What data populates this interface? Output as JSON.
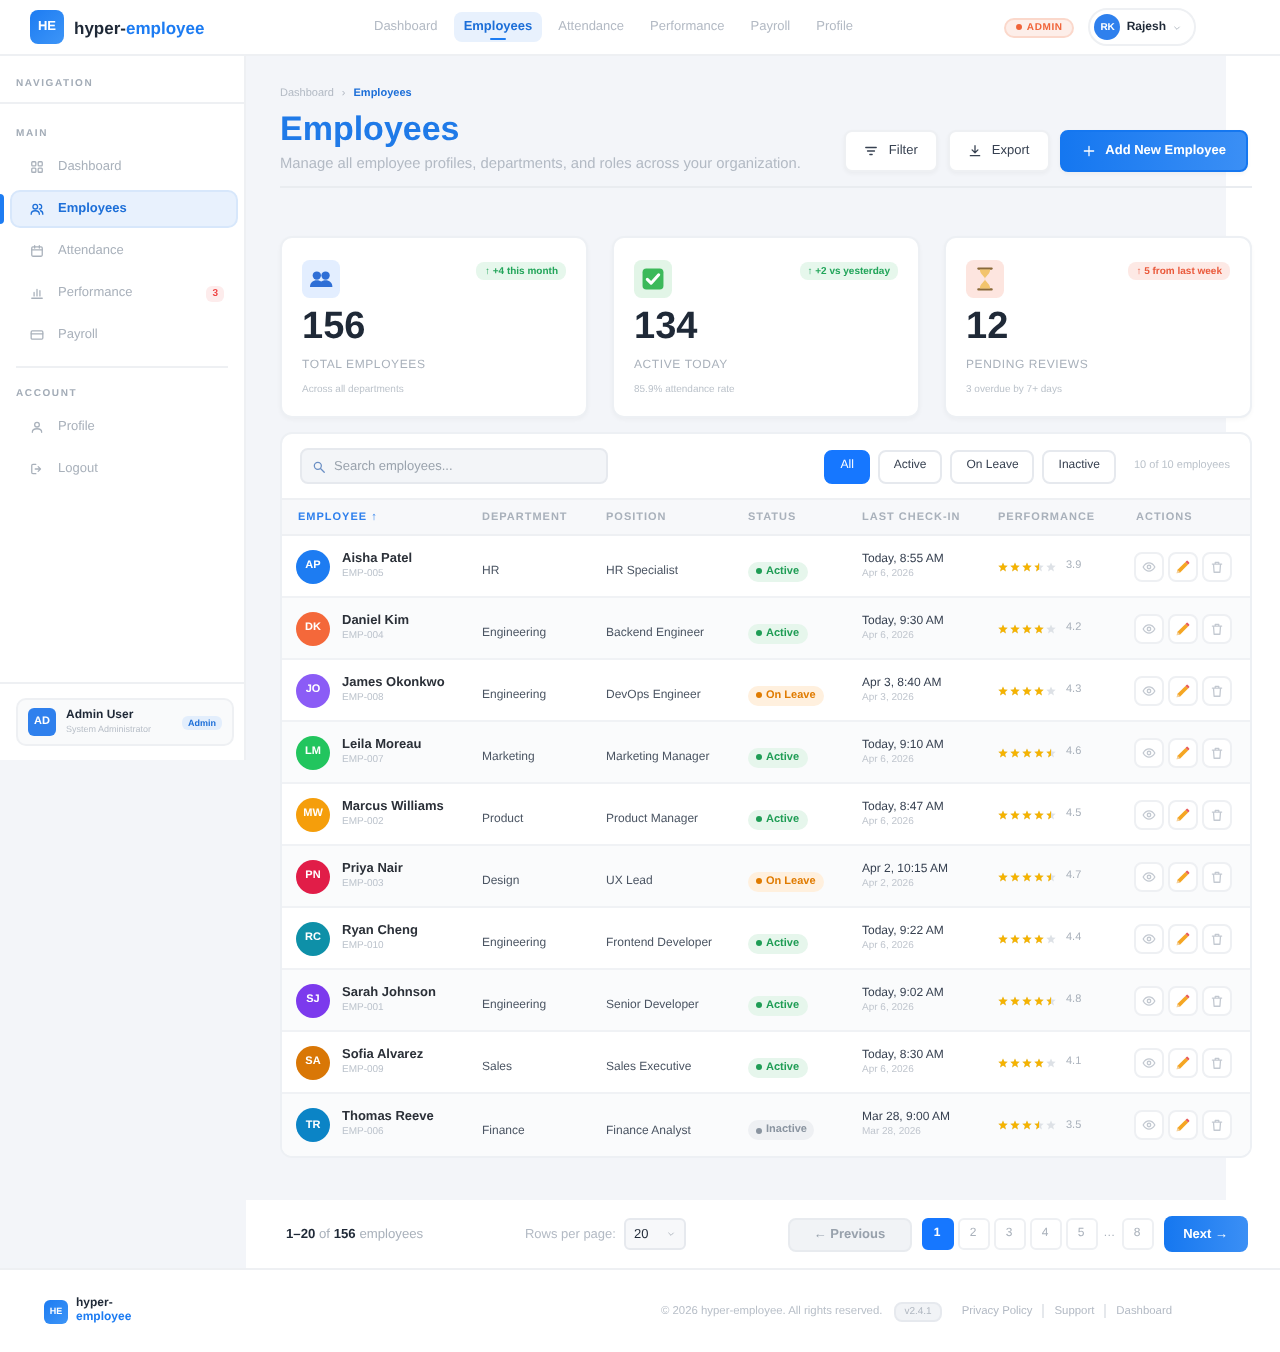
{
  "header": {
    "logo": "HE",
    "brand": {
      "part_1": "hyper-",
      "part_2": "employee"
    },
    "nav": [
      {
        "label": "Dashboard",
        "selected": false
      },
      {
        "label": "Employees",
        "selected": true
      },
      {
        "label": "Attendance",
        "selected": false
      },
      {
        "label": "Performance",
        "selected": false
      },
      {
        "label": "Payroll",
        "selected": false
      },
      {
        "label": "Profile",
        "selected": false
      }
    ],
    "role_badge": "ADMIN",
    "user": {
      "initials": "RK",
      "name": "Rajesh"
    }
  },
  "sidebar": {
    "heading": "NAVIGATION",
    "sections": [
      {
        "title": "MAIN",
        "items": [
          {
            "label": "Dashboard",
            "selected": false
          },
          {
            "label": "Employees",
            "selected": true
          },
          {
            "label": "Attendance",
            "selected": false
          },
          {
            "label": "Performance",
            "selected": false,
            "badge": "3"
          },
          {
            "label": "Payroll",
            "selected": false
          }
        ]
      },
      {
        "title": "ACCOUNT",
        "items": [
          {
            "label": "Profile",
            "selected": false
          },
          {
            "label": "Logout",
            "selected": false
          }
        ]
      }
    ],
    "user_card": {
      "initials": "AD",
      "name": "Admin User",
      "role": "System Administrator",
      "badge": "Admin"
    }
  },
  "page": {
    "breadcrumb": {
      "separator": "›",
      "items": [
        {
          "label": "Dashboard",
          "current": false
        },
        {
          "label": "Employees",
          "current": true
        }
      ]
    },
    "title": "Employees",
    "subtitle": "Manage all employee profiles, departments, and roles across your organization.",
    "actions": [
      {
        "label": "Filter",
        "kind": "secondary"
      },
      {
        "label": "Export",
        "kind": "secondary"
      },
      {
        "label": "Add New Employee",
        "kind": "primary"
      }
    ]
  },
  "stats": [
    {
      "trend": {
        "label": "↑ +4 this month",
        "kind": "good"
      },
      "value": "156",
      "label": "TOTAL EMPLOYEES",
      "note": "Across all departments"
    },
    {
      "trend": {
        "label": "↑ +2 vs yesterday",
        "kind": "good"
      },
      "value": "134",
      "label": "ACTIVE TODAY",
      "note": "85.9% attendance rate"
    },
    {
      "trend": {
        "label": "↑ 5 from last week",
        "kind": "bad"
      },
      "value": "12",
      "label": "PENDING REVIEWS",
      "note": "3 overdue by 7+ days"
    }
  ],
  "table": {
    "search": {
      "placeholder": "Search employees..."
    },
    "filters": [
      {
        "label": "All",
        "selected": true
      },
      {
        "label": "Active",
        "selected": false
      },
      {
        "label": "On Leave",
        "selected": false
      },
      {
        "label": "Inactive",
        "selected": false
      }
    ],
    "count": "10 of 10 employees",
    "columns": [
      {
        "label": "EMPLOYEE",
        "sorted": true,
        "sort_indicator": "↑"
      },
      {
        "label": "DEPARTMENT",
        "sorted": false
      },
      {
        "label": "POSITION",
        "sorted": false
      },
      {
        "label": "STATUS",
        "sorted": false
      },
      {
        "label": "LAST CHECK-IN",
        "sorted": false
      },
      {
        "label": "PERFORMANCE",
        "sorted": false
      },
      {
        "label": "ACTIONS",
        "sorted": false
      }
    ],
    "rows": [
      {
        "initials": "AP",
        "color": "#1d7cf2",
        "name": "Aisha Patel",
        "id": "EMP-005",
        "department": "HR",
        "position": "HR Specialist",
        "status": {
          "kind": "active",
          "label": "Active"
        },
        "check_in": "Today, 8:55 AM",
        "check_in_date": "Apr 6, 2026",
        "stars": 3.5,
        "rating": "3.9"
      },
      {
        "initials": "DK",
        "color": "#f4683a",
        "name": "Daniel Kim",
        "id": "EMP-004",
        "department": "Engineering",
        "position": "Backend Engineer",
        "status": {
          "kind": "active",
          "label": "Active"
        },
        "check_in": "Today, 9:30 AM",
        "check_in_date": "Apr 6, 2026",
        "stars": 4,
        "rating": "4.2"
      },
      {
        "initials": "JO",
        "color": "#8b5cf6",
        "name": "James Okonkwo",
        "id": "EMP-008",
        "department": "Engineering",
        "position": "DevOps Engineer",
        "status": {
          "kind": "on_leave",
          "label": "On Leave"
        },
        "check_in": "Apr 3, 8:40 AM",
        "check_in_date": "Apr 3, 2026",
        "stars": 4,
        "rating": "4.3"
      },
      {
        "initials": "LM",
        "color": "#22c55e",
        "name": "Leila Moreau",
        "id": "EMP-007",
        "department": "Marketing",
        "position": "Marketing Manager",
        "status": {
          "kind": "active",
          "label": "Active"
        },
        "check_in": "Today, 9:10 AM",
        "check_in_date": "Apr 6, 2026",
        "stars": 4.5,
        "rating": "4.6"
      },
      {
        "initials": "MW",
        "color": "#f59e0b",
        "name": "Marcus Williams",
        "id": "EMP-002",
        "department": "Product",
        "position": "Product Manager",
        "status": {
          "kind": "active",
          "label": "Active"
        },
        "check_in": "Today, 8:47 AM",
        "check_in_date": "Apr 6, 2026",
        "stars": 4.5,
        "rating": "4.5"
      },
      {
        "initials": "PN",
        "color": "#e11d48",
        "name": "Priya Nair",
        "id": "EMP-003",
        "department": "Design",
        "position": "UX Lead",
        "status": {
          "kind": "on_leave",
          "label": "On Leave"
        },
        "check_in": "Apr 2, 10:15 AM",
        "check_in_date": "Apr 2, 2026",
        "stars": 4.5,
        "rating": "4.7"
      },
      {
        "initials": "RC",
        "color": "#0e90a8",
        "name": "Ryan Cheng",
        "id": "EMP-010",
        "department": "Engineering",
        "position": "Frontend Developer",
        "status": {
          "kind": "active",
          "label": "Active"
        },
        "check_in": "Today, 9:22 AM",
        "check_in_date": "Apr 6, 2026",
        "stars": 4,
        "rating": "4.4"
      },
      {
        "initials": "SJ",
        "color": "#7c3aed",
        "name": "Sarah Johnson",
        "id": "EMP-001",
        "department": "Engineering",
        "position": "Senior Developer",
        "status": {
          "kind": "active",
          "label": "Active"
        },
        "check_in": "Today, 9:02 AM",
        "check_in_date": "Apr 6, 2026",
        "stars": 4.5,
        "rating": "4.8"
      },
      {
        "initials": "SA",
        "color": "#d97706",
        "name": "Sofia Alvarez",
        "id": "EMP-009",
        "department": "Sales",
        "position": "Sales Executive",
        "status": {
          "kind": "active",
          "label": "Active"
        },
        "check_in": "Today, 8:30 AM",
        "check_in_date": "Apr 6, 2026",
        "stars": 4,
        "rating": "4.1"
      },
      {
        "initials": "TR",
        "color": "#0b84c6",
        "name": "Thomas Reeve",
        "id": "EMP-006",
        "department": "Finance",
        "position": "Finance Analyst",
        "status": {
          "kind": "inactive",
          "label": "Inactive"
        },
        "check_in": "Mar 28, 9:00 AM",
        "check_in_date": "Mar 28, 2026",
        "stars": 3.5,
        "rating": "3.5"
      }
    ]
  },
  "pagination": {
    "summary": "**1–20** of **156** employees",
    "rows_label": "Rows per page:",
    "rows_value": "20",
    "previous": {
      "label": "← Previous",
      "disabled": true
    },
    "pages": [
      {
        "label": "1",
        "kind": "page",
        "selected": true
      },
      {
        "label": "2",
        "kind": "page",
        "selected": false
      },
      {
        "label": "3",
        "kind": "page",
        "selected": false
      },
      {
        "label": "4",
        "kind": "page",
        "selected": false
      },
      {
        "label": "5",
        "kind": "page",
        "selected": false
      },
      {
        "label": "…",
        "kind": "ellipsis",
        "selected": false
      },
      {
        "label": "8",
        "kind": "page",
        "selected": false
      }
    ],
    "next": {
      "label": "Next →",
      "disabled": false
    }
  },
  "footer": {
    "logo": "HE",
    "brand": {
      "part_1": "hyper-",
      "part_2": "employee"
    },
    "copyright": "© 2026 hyper-employee. All rights reserved.",
    "version": "v2.4.1",
    "links": [
      "Privacy Policy",
      "Support",
      "Dashboard"
    ]
  }
}
